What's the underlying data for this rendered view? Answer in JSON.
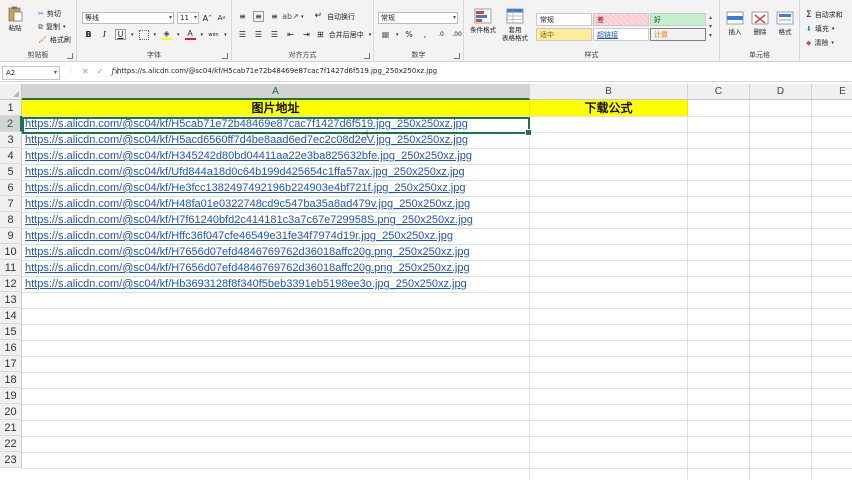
{
  "ribbon": {
    "clipboard": {
      "paste": "粘贴",
      "cut": "剪切",
      "copy": "复制",
      "format_painter": "格式刷",
      "label": "剪贴板"
    },
    "font": {
      "font_name": "等线",
      "font_size": "11",
      "increase": "A",
      "decrease": "A",
      "bold": "B",
      "italic": "I",
      "underline": "U",
      "wen": "wén",
      "label": "字体"
    },
    "alignment": {
      "wrap_text": "自动换行",
      "merge_center": "合并后居中",
      "label": "对齐方式"
    },
    "number": {
      "format": "常规",
      "percent": "%",
      "label": "数字"
    },
    "styles": {
      "conditional": "条件格式",
      "table_format": "套用\n表格格式",
      "normal": "常规",
      "bad": "差",
      "good": "好",
      "neutral": "适中",
      "hyperlink": "超链接",
      "calculation": "计算",
      "label": "样式"
    },
    "cells": {
      "insert": "插入",
      "delete": "删除",
      "format": "格式",
      "label": "单元格"
    },
    "editing": {
      "autosum": "自动求和",
      "fill": "填充",
      "clear": "清除"
    }
  },
  "formula_bar": {
    "name_box": "A2",
    "fx": "fx",
    "content": "https://s.alicdn.com/@sc04/kf/H5cab71e72b48469e87cac7f1427d6f519.jpg_250x250xz.jpg"
  },
  "sheet": {
    "columns": [
      "A",
      "B",
      "C",
      "D",
      "E"
    ],
    "rows": [
      "1",
      "2",
      "3",
      "4",
      "5",
      "6",
      "7",
      "8",
      "9",
      "10",
      "11",
      "12",
      "13",
      "14",
      "15",
      "16",
      "17",
      "18",
      "19",
      "20",
      "21",
      "22",
      "23"
    ],
    "header_a": "图片地址",
    "header_b": "下载公式",
    "links": [
      "https://s.alicdn.com/@sc04/kf/H5cab71e72b48469e87cac7f1427d6f519.jpg_250x250xz.jpg",
      "https://s.alicdn.com/@sc04/kf/H5acd6560ff7d4be8aad6ed7ec2c08d2eV.jpg_250x250xz.jpg",
      "https://s.alicdn.com/@sc04/kf/H345242d80bd04411aa22e3ba825632bfe.jpg_250x250xz.jpg",
      "https://s.alicdn.com/@sc04/kf/Ufd844a18d0c64b199d425654c1ffa57ax.jpg_250x250xz.jpg",
      "https://s.alicdn.com/@sc04/kf/He3fcc1382497492196b224903e4bf721f.jpg_250x250xz.jpg",
      "https://s.alicdn.com/@sc04/kf/H48fa01e0322748cd9c547ba35a8ad479v.jpg_250x250xz.jpg",
      "https://s.alicdn.com/@sc04/kf/H7f61240bfd2c414181c3a7c67e729958S.png_250x250xz.jpg",
      "https://s.alicdn.com/@sc04/kf/Hffc36f047cfe46549e31fe34f7974d19r.jpg_250x250xz.jpg",
      "https://s.alicdn.com/@sc04/kf/H7656d07efd4846769762d36018affc20g.png_250x250xz.jpg",
      "https://s.alicdn.com/@sc04/kf/H7656d07efd4846769762d36018affc20g.png_250x250xz.jpg",
      "https://s.alicdn.com/@sc04/kf/Hb3693128f8f340f5beb3391eb5198ee3o.jpg_250x250xz.jpg"
    ]
  },
  "colors": {
    "header_fill": "#ffff00",
    "link": "#1f57b6",
    "selection": "#217346"
  }
}
